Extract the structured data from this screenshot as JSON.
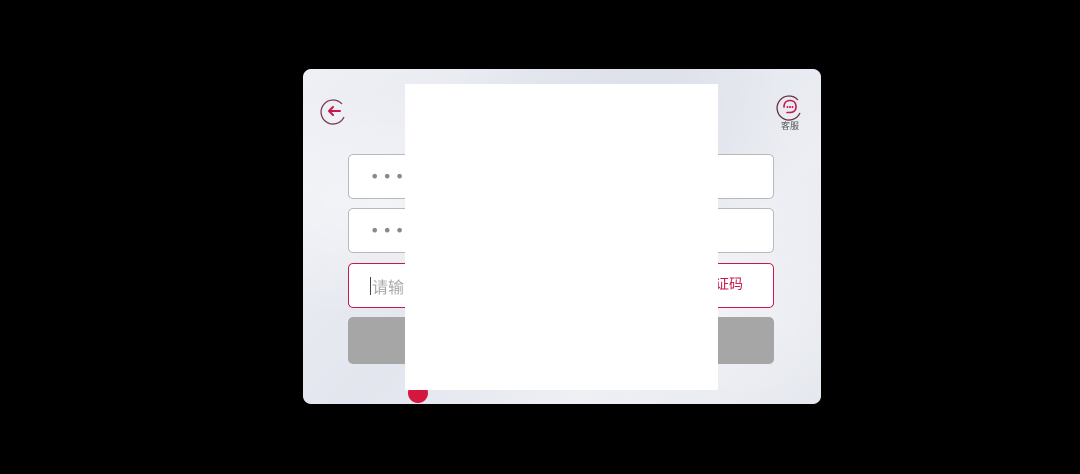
{
  "header": {
    "back_icon": "back-arrow-icon",
    "service_icon": "customer-service-icon",
    "service_label": "客服"
  },
  "form": {
    "field_1_masked": "••••",
    "field_2_masked": "••••",
    "code_field_text": "请输",
    "get_code_label": "证码"
  },
  "colors": {
    "accent": "#c8174a",
    "submit_disabled": "#a6a6a6",
    "overlay": "#ffffff",
    "background": "#000000"
  }
}
